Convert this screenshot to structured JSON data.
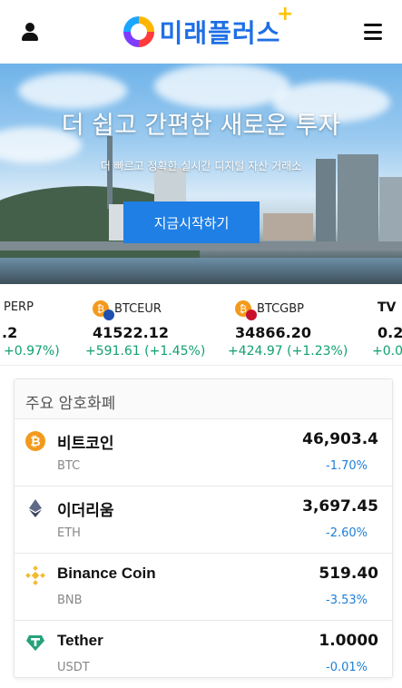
{
  "header": {
    "logo_text": "미래플러스",
    "logo_plus": "+"
  },
  "hero": {
    "title": "더 쉽고 간편한 새로운 투자",
    "subtitle": "더 빠르고 정확한 실시간 디지털 자산 거래소",
    "start_button": "지금시작하기"
  },
  "ticker": [
    {
      "symbol": "PERP",
      "price": ".2",
      "change": "+0.97%)"
    },
    {
      "symbol": "BTCEUR",
      "price": "41522.12",
      "change": "+591.61 (+1.45%)"
    },
    {
      "symbol": "BTCGBP",
      "price": "34866.20",
      "change": "+424.97 (+1.23%)"
    },
    {
      "symbol": "",
      "price": "0.2",
      "change": "+0.0"
    }
  ],
  "ticker_badge": "TV",
  "card": {
    "title": "주요 암호화폐",
    "rows": [
      {
        "name": "비트코인",
        "symbol": "BTC",
        "price": "46,903.4",
        "change": "-1.70%"
      },
      {
        "name": "이더리움",
        "symbol": "ETH",
        "price": "3,697.45",
        "change": "-2.60%"
      },
      {
        "name": "Binance Coin",
        "symbol": "BNB",
        "price": "519.40",
        "change": "-3.53%"
      },
      {
        "name": "Tether",
        "symbol": "USDT",
        "price": "1.0000",
        "change": "-0.01%"
      }
    ]
  },
  "colors": {
    "brand_blue": "#1f6fe5",
    "button_blue": "#1f7fe5",
    "positive_green": "#12a071",
    "change_blue": "#1e7fd6",
    "btc_orange": "#f39a1c",
    "bnb_yellow": "#f3ba2f",
    "usdt_green": "#26a17b"
  },
  "icons": [
    "user-icon",
    "menu-icon",
    "bitcoin-icon",
    "ethereum-icon",
    "binance-icon",
    "tether-icon"
  ]
}
